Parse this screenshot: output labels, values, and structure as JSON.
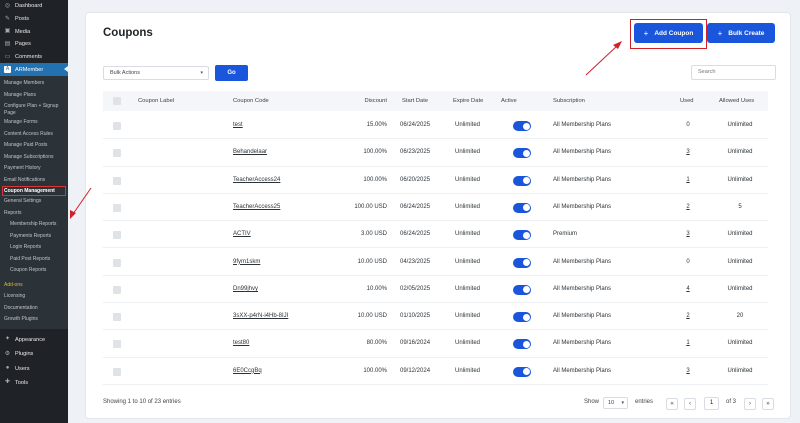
{
  "sidebar": {
    "top_items": [
      {
        "label": "Dashboard",
        "icon": "dashboard-icon"
      },
      {
        "label": "Posts",
        "icon": "pin-icon"
      },
      {
        "label": "Media",
        "icon": "media-icon"
      },
      {
        "label": "Pages",
        "icon": "pages-icon"
      },
      {
        "label": "Comments",
        "icon": "comment-icon"
      }
    ],
    "active": {
      "label": "ARMember",
      "icon": "armember-icon"
    },
    "submenu": [
      "Manage Members",
      "Manage Plans",
      "Configure Plan + Signup Page",
      "Manage Forms",
      "Content Access Rules",
      "Manage Paid Posts",
      "Manage Subscriptions",
      "Payment History",
      "Email Notifications",
      "Coupon Management",
      "General Settings",
      "Reports"
    ],
    "reports_sub": [
      "Membership Reports",
      "Payments Reports",
      "Login Reports",
      "Paid Post Reports",
      "Coupon Reports"
    ],
    "addons": "Add-ons",
    "misc": [
      "Licensing",
      "Documentation",
      "Growth Plugins"
    ],
    "bottom_items": [
      {
        "label": "Appearance",
        "icon": "paintbrush-icon"
      },
      {
        "label": "Plugins",
        "icon": "plugin-icon"
      },
      {
        "label": "Users",
        "icon": "users-icon"
      },
      {
        "label": "Tools",
        "icon": "tools-icon"
      }
    ]
  },
  "header": {
    "title": "Coupons",
    "add_label": "Add Coupon",
    "bulk_create_label": "Bulk Create"
  },
  "filters": {
    "bulk_actions": "Bulk Actions",
    "go": "Go",
    "search_placeholder": "Search"
  },
  "table": {
    "columns": [
      "Coupon Label",
      "Coupon Code",
      "Discount",
      "Start Date",
      "Expire Date",
      "Active",
      "Subscription",
      "Used",
      "Allowed Uses"
    ],
    "rows": [
      {
        "label": "",
        "code": "test",
        "discount": "15.00%",
        "start": "06/24/2025",
        "expire": "Unlimited",
        "active": true,
        "subscription": "All Membership Plans",
        "used": "0",
        "used_link": false,
        "allowed": "Unlimited"
      },
      {
        "label": "",
        "code": "Behandelaar",
        "discount": "100.00%",
        "start": "06/23/2025",
        "expire": "Unlimited",
        "active": true,
        "subscription": "All Membership Plans",
        "used": "3",
        "used_link": true,
        "allowed": "Unlimited"
      },
      {
        "label": "",
        "code": "TeacherAccess24",
        "discount": "100.00%",
        "start": "06/20/2025",
        "expire": "Unlimited",
        "active": true,
        "subscription": "All Membership Plans",
        "used": "1",
        "used_link": true,
        "allowed": "Unlimited"
      },
      {
        "label": "",
        "code": "TeacherAccess25",
        "discount": "100.00 USD",
        "start": "06/24/2025",
        "expire": "Unlimited",
        "active": true,
        "subscription": "All Membership Plans",
        "used": "2",
        "used_link": true,
        "allowed": "5"
      },
      {
        "label": "",
        "code": "ACTIV",
        "discount": "3.00 USD",
        "start": "06/24/2025",
        "expire": "Unlimited",
        "active": true,
        "subscription": "Premium",
        "used": "3",
        "used_link": true,
        "allowed": "Unlimited"
      },
      {
        "label": "",
        "code": "9fym1skm",
        "discount": "10.00 USD",
        "start": "04/23/2025",
        "expire": "Unlimited",
        "active": true,
        "subscription": "All Membership Plans",
        "used": "0",
        "used_link": false,
        "allowed": "Unlimited"
      },
      {
        "label": "",
        "code": "Dn99jhvy",
        "discount": "10.00%",
        "start": "02/05/2025",
        "expire": "Unlimited",
        "active": true,
        "subscription": "All Membership Plans",
        "used": "4",
        "used_link": true,
        "allowed": "Unlimited"
      },
      {
        "label": "",
        "code": "3sXX-p4rN-i4Hb-8IJI",
        "discount": "10.00 USD",
        "start": "01/10/2025",
        "expire": "Unlimited",
        "active": true,
        "subscription": "All Membership Plans",
        "used": "2",
        "used_link": true,
        "allowed": "20"
      },
      {
        "label": "",
        "code": "test80",
        "discount": "80.00%",
        "start": "09/16/2024",
        "expire": "Unlimited",
        "active": true,
        "subscription": "All Membership Plans",
        "used": "1",
        "used_link": true,
        "allowed": "Unlimited"
      },
      {
        "label": "",
        "code": "6E0CcgBq",
        "discount": "100.00%",
        "start": "09/12/2024",
        "expire": "Unlimited",
        "active": true,
        "subscription": "All Membership Plans",
        "used": "3",
        "used_link": true,
        "allowed": "Unlimited"
      }
    ]
  },
  "footer": {
    "info": "Showing 1 to 10 of 23 entries",
    "show_label": "Show",
    "page_size": "10",
    "entries_label": "entries",
    "current_page": "1",
    "of_pages": "of 3",
    "first": "«",
    "prev": "‹",
    "next": "›",
    "last": "»"
  },
  "colors": {
    "primary": "#1a56db",
    "sidebar_bg": "#1f2327",
    "sidebar_active": "#2271b1",
    "annotation": "#d0202a"
  }
}
